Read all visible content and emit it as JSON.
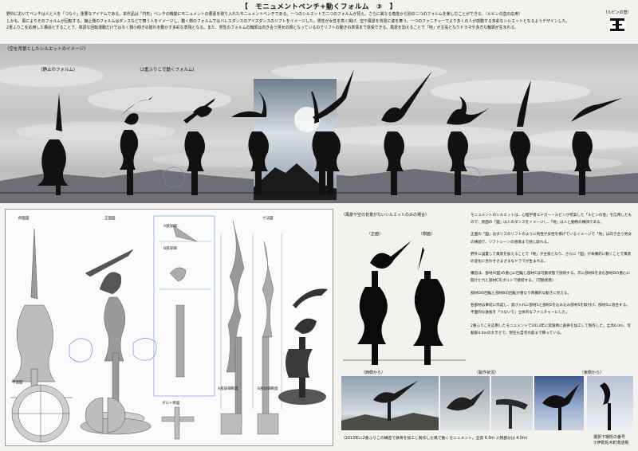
{
  "title": "【　モニュメントベンチ+動くフォルム　③　】",
  "intro": [
    "野外においてベンチは人と人を「つなぐ」重要なアイテムである。本作品は「円形」ベンチの機能にモニュメントの要素を取り入れたモニュメントベンチである。一つのシルエットで二つのフォルムが見え、さらに異なる角度から別の二つのフォルムを楽しむことができる。（ルビンの壺の応用）",
    "しかも、風によりそのフォルムが回転する。静止側のフォルムはダンスなどで舞う人をイメージし、動く側のフォルムではバレエダンスのアイスダンスのリフトをイメージした。男性が女性を高く掲げ、空や風景を背景に姿を舞う。一つのファニチャーでより多くの人が感動する多彩なシルエットとなるようデザインした。",
    "2重ふりこを応用した構造とすることで、単調な回転運動だけではなく微小傾きの揺れを動かす多彩な表現となる。また、男性のフォルムの輪郭は向き合う男女の顔となっているのでリフトの動きの表情まで感受できる。風景を加えることで「地」が主役となりドラマや多方な輪郭が生まれる。"
  ],
  "logo_caption": "（ルビンの壺）",
  "panorama": {
    "caption": "（空を背景としたシルエットのイメージ）",
    "label_static": "（静止のフォルム）",
    "label_moving": "（2重ふりこで動くフォルム）"
  },
  "drawing": {
    "front_label": "側面図",
    "side_label": "正面図",
    "detail_a": "A部詳細",
    "detail_b": "B部詳細",
    "plan_label": "平面図",
    "bolt_label": "ボルト断面",
    "joint_a": "A部詳細断面",
    "joint_b": "B部詳細断面",
    "dim_label": "寸法図"
  },
  "mid": {
    "caption": "（風景や空の背景がないシルエットのみの場合）",
    "front": "（正面）",
    "side": "（側面）"
  },
  "description": [
    "モニュメントのシルエットは、心理学者エドガー・ルビンが考案した「ルビンの壺」を応用したもので、黒面の「図」は人のダンスをイメージし、「地」は人と動物の横顔である。",
    "正面の「図」はダンスのリフトのように男性が女性を掲げているイメージで「地」は向き合う男女の横顔で、リフトシーンの感情まで感じ取れる。",
    "野外に設置して風景を加えることで「地」が主役となり、さらに「図」が本機的に動くことで風景の変化に合わせさまざまなドラマが生まれる。",
    "構造は、部材A(図)の重心に回転し部材Cは可動状態で接続する。次に部材Bを含む部材Dの重心に開けた穴と部材Cをボルトで接続する。（可動状態）",
    "部材Dの回転と部材Bの回転が重なり両機的な動きに見える。",
    "各部材は事前に作成し、溶け入れに部材1と部材2を込み込み部材5を取付け、部材5に溶合する。平面的な鉄板を「つないで」立体的なファニチャーにした。",
    "2重ふりこを応用したモニュメントで2013年に実施例に鉄骨を加工して製作した。全高6.0m、可動部4.0mの大きさで、現在も自宅の庭まで飾っている。"
  ],
  "photos": {
    "cap1": "（西側から）",
    "cap2": "（製作状況）",
    "cap3": "（東側から）"
  },
  "footer_left": "（2013年に2重ふりこの構造で鉄骨を加工し製作した風で動くモニュメント。全高 6.0ｍ 人物部分は 4.0ｍ）",
  "footer_right": [
    "選択下場所の番号",
    "①伊勢佐木町商店街"
  ]
}
